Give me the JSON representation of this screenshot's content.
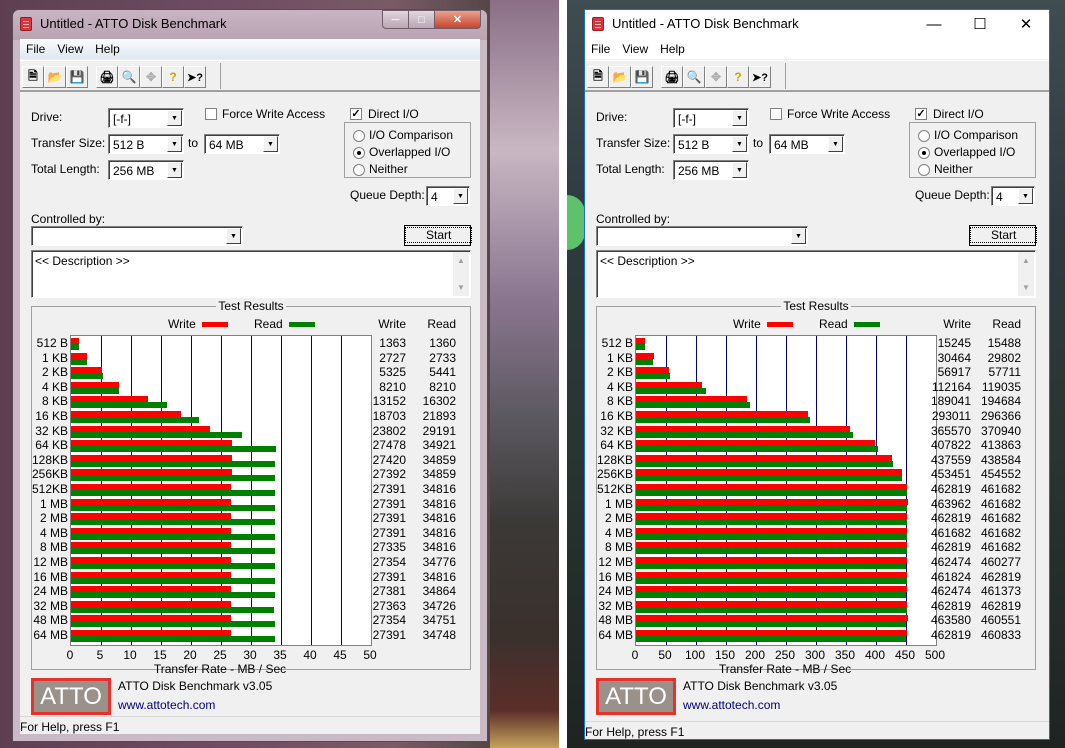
{
  "windows": [
    {
      "style": "win7",
      "title": "Untitled - ATTO Disk Benchmark",
      "menu": [
        "File",
        "View",
        "Help"
      ],
      "toolbar": [
        "new-icon",
        "open-icon",
        "save-icon",
        "print-icon",
        "print-preview-icon",
        "move-icon",
        "help-icon",
        "context-help-icon"
      ],
      "form": {
        "drive_label": "Drive:",
        "drive_value": "[-f-]",
        "transfer_size_label": "Transfer Size:",
        "transfer_from": "512 B",
        "to_label": "to",
        "transfer_to": "64 MB",
        "total_length_label": "Total Length:",
        "total_length_value": "256 MB",
        "force_write_label": "Force Write Access",
        "force_write_checked": false,
        "direct_io_label": "Direct I/O",
        "direct_io_checked": true,
        "radios": [
          {
            "label": "I/O Comparison",
            "checked": false
          },
          {
            "label": "Overlapped I/O",
            "checked": true
          },
          {
            "label": "Neither",
            "checked": false
          }
        ],
        "queue_depth_label": "Queue Depth:",
        "queue_depth_value": "4",
        "controlled_by_label": "Controlled by:",
        "controlled_by_value": "",
        "start_label": "Start",
        "description": "<< Description >>"
      },
      "results_title": "Test Results",
      "legend_write": "Write",
      "legend_read": "Read",
      "col_write": "Write",
      "col_read": "Read",
      "footer": {
        "logo": "ATTO",
        "product": "ATTO Disk Benchmark v3.05",
        "url": "www.attotech.com"
      },
      "status": "For Help, press F1"
    },
    {
      "style": "win10",
      "title": "Untitled - ATTO Disk Benchmark",
      "menu": [
        "File",
        "View",
        "Help"
      ],
      "toolbar": [
        "new-icon",
        "open-icon",
        "save-icon",
        "print-icon",
        "print-preview-icon",
        "move-icon",
        "help-icon",
        "context-help-icon"
      ],
      "form": {
        "drive_label": "Drive:",
        "drive_value": "[-f-]",
        "transfer_size_label": "Transfer Size:",
        "transfer_from": "512 B",
        "to_label": "to",
        "transfer_to": "64 MB",
        "total_length_label": "Total Length:",
        "total_length_value": "256 MB",
        "force_write_label": "Force Write Access",
        "force_write_checked": false,
        "direct_io_label": "Direct I/O",
        "direct_io_checked": true,
        "radios": [
          {
            "label": "I/O Comparison",
            "checked": false
          },
          {
            "label": "Overlapped I/O",
            "checked": true
          },
          {
            "label": "Neither",
            "checked": false
          }
        ],
        "queue_depth_label": "Queue Depth:",
        "queue_depth_value": "4",
        "controlled_by_label": "Controlled by:",
        "controlled_by_value": "",
        "start_label": "Start",
        "description": "<< Description >>"
      },
      "results_title": "Test Results",
      "legend_write": "Write",
      "legend_read": "Read",
      "col_write": "Write",
      "col_read": "Read",
      "footer": {
        "logo": "ATTO",
        "product": "ATTO Disk Benchmark v3.05",
        "url": "www.attotech.com"
      },
      "status": "For Help, press F1"
    }
  ],
  "colors": {
    "write": "#ff0000",
    "read": "#008000",
    "grid": "#000080",
    "link": "#000080",
    "logo_border": "#e8302c",
    "logo_bg": "#9a928a"
  },
  "chart_data": [
    {
      "type": "bar",
      "orientation": "horizontal",
      "title": "Test Results",
      "xlabel": "Transfer Rate - MB / Sec",
      "xlim": [
        0,
        50
      ],
      "xticks": [
        0,
        5,
        10,
        15,
        20,
        25,
        30,
        35,
        40,
        45,
        50
      ],
      "grid": true,
      "legend": "top",
      "categories": [
        "512 B",
        "1 KB",
        "2 KB",
        "4 KB",
        "8 KB",
        "16 KB",
        "32 KB",
        "64 KB",
        "128KB",
        "256KB",
        "512KB",
        "1 MB",
        "2 MB",
        "4 MB",
        "8 MB",
        "12 MB",
        "16 MB",
        "24 MB",
        "32 MB",
        "48 MB",
        "64 MB"
      ],
      "value_units": "KB/s",
      "series": [
        {
          "name": "Write",
          "values": [
            1363,
            2727,
            5325,
            8210,
            13152,
            18703,
            23802,
            27478,
            27420,
            27392,
            27391,
            27391,
            27391,
            27391,
            27335,
            27354,
            27391,
            27381,
            27363,
            27354,
            27391
          ]
        },
        {
          "name": "Read",
          "values": [
            1360,
            2733,
            5441,
            8210,
            16302,
            21893,
            29191,
            34921,
            34859,
            34859,
            34816,
            34816,
            34816,
            34816,
            34816,
            34776,
            34816,
            34864,
            34726,
            34751,
            34748
          ]
        }
      ]
    },
    {
      "type": "bar",
      "orientation": "horizontal",
      "title": "Test Results",
      "xlabel": "Transfer Rate - MB / Sec",
      "xlim": [
        0,
        500
      ],
      "xticks": [
        0,
        50,
        100,
        150,
        200,
        250,
        300,
        350,
        400,
        450,
        500
      ],
      "grid": true,
      "legend": "top",
      "categories": [
        "512 B",
        "1 KB",
        "2 KB",
        "4 KB",
        "8 KB",
        "16 KB",
        "32 KB",
        "64 KB",
        "128KB",
        "256KB",
        "512KB",
        "1 MB",
        "2 MB",
        "4 MB",
        "8 MB",
        "12 MB",
        "16 MB",
        "24 MB",
        "32 MB",
        "48 MB",
        "64 MB"
      ],
      "value_units": "KB/s",
      "series": [
        {
          "name": "Write",
          "values": [
            15245,
            30464,
            56917,
            112164,
            189041,
            293011,
            365570,
            407822,
            437559,
            453451,
            462819,
            463962,
            462819,
            461682,
            462819,
            462474,
            461824,
            462474,
            462819,
            463580,
            462819
          ]
        },
        {
          "name": "Read",
          "values": [
            15488,
            29802,
            57711,
            119035,
            194684,
            296366,
            370940,
            413863,
            438584,
            454552,
            461682,
            461682,
            461682,
            461682,
            461682,
            460277,
            462819,
            461373,
            462819,
            460551,
            460833
          ]
        }
      ]
    }
  ]
}
